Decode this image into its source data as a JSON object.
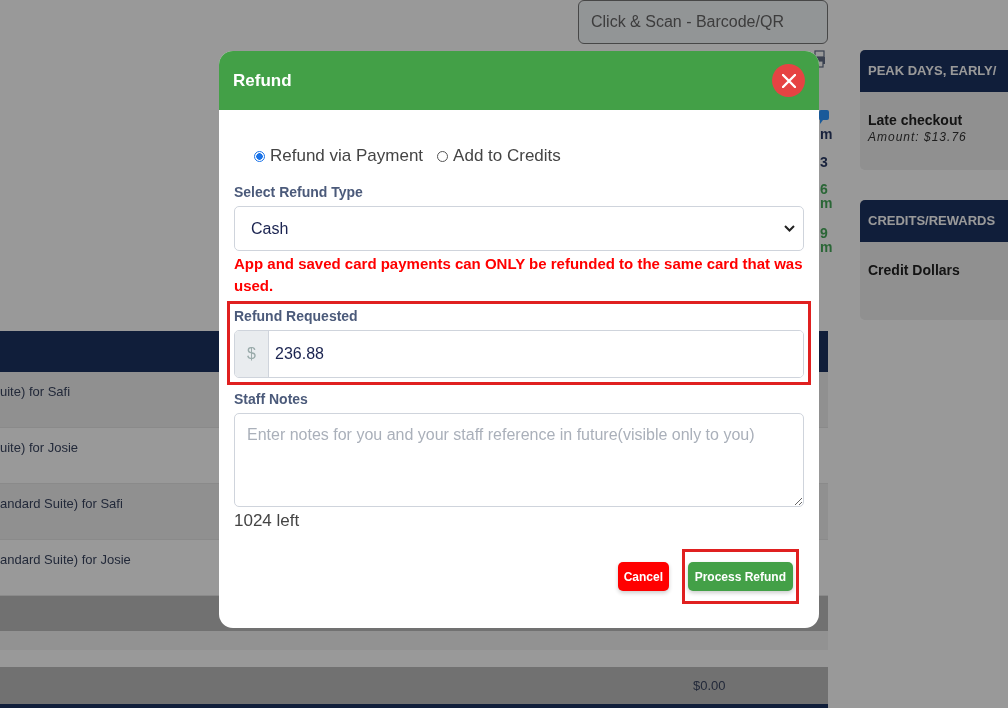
{
  "background": {
    "scan_field": {
      "placeholder": "Click & Scan - Barcode/QR"
    },
    "edge_fragments": [
      {
        "text": "m",
        "color": "#18223c"
      },
      {
        "text": "3",
        "color": "#18223c"
      },
      {
        "text": "6",
        "color": "#2a6636"
      },
      {
        "text": "m",
        "color": "#2a6636"
      },
      {
        "text": "9",
        "color": "#2a6636"
      },
      {
        "text": "m",
        "color": "#2a6636"
      }
    ],
    "table": {
      "rows": [
        {
          "text": "uite) for Safi"
        },
        {
          "text": "uite) for Josie"
        },
        {
          "text": "andard Suite) for Safi"
        },
        {
          "text": "andard Suite) for Josie"
        }
      ],
      "total": "$0.00"
    }
  },
  "sidebar": [
    {
      "title": "PEAK DAYS, EARLY/",
      "lines": [
        {
          "text": "Late checkout",
          "kind": "label"
        },
        {
          "text": "Amount: $13.76",
          "kind": "amount"
        }
      ]
    },
    {
      "title": "CREDITS/REWARDS",
      "lines": [
        {
          "text": "Credit Dollars",
          "kind": "label"
        }
      ]
    }
  ],
  "dialog": {
    "title": "Refund",
    "refund_methods": [
      {
        "label": "Refund via Payment",
        "selected": true
      },
      {
        "label": "Add to Credits",
        "selected": false
      }
    ],
    "refund_type": {
      "label": "Select Refund Type",
      "value": "Cash"
    },
    "warning": "App and saved card payments can ONLY be refunded to the same card that was used.",
    "refund_requested": {
      "label": "Refund Requested",
      "prefix": "$",
      "value": "236.88",
      "highlighted": true
    },
    "staff_notes": {
      "label": "Staff Notes",
      "placeholder": "Enter notes for you and your staff reference in future(visible only to you)"
    },
    "chars_left": "1024 left",
    "buttons": [
      {
        "label": "Cancel",
        "kind": "cancel",
        "highlighted": false
      },
      {
        "label": "Process Refund",
        "kind": "primary",
        "highlighted": true
      }
    ]
  }
}
